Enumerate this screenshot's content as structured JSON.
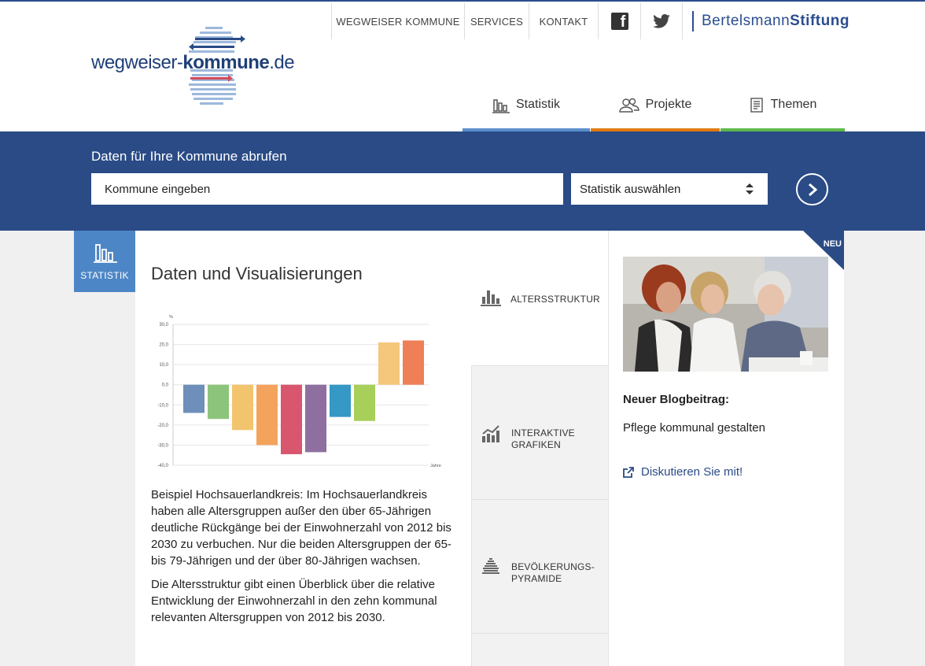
{
  "header": {
    "top_nav": [
      "WEGWEISER KOMMUNE",
      "SERVICES",
      "KONTAKT"
    ],
    "social": [
      "facebook-icon",
      "twitter-icon"
    ],
    "brand_part1": "Bertelsmann",
    "brand_part2": "Stiftung",
    "logo_part1": "wegweiser-",
    "logo_part2": "kommune",
    "logo_part3": ".de",
    "main_nav": [
      {
        "label": "Statistik",
        "color": "#5b8fcb"
      },
      {
        "label": "Projekte",
        "color": "#e07a10"
      },
      {
        "label": "Themen",
        "color": "#5db84a"
      }
    ]
  },
  "search": {
    "title": "Daten für Ihre Kommune abrufen",
    "kommune_placeholder": "Kommune eingeben",
    "statistik_selected": "Statistik auswählen"
  },
  "sidebar_tile": {
    "label": "STATISTIK"
  },
  "main": {
    "title": "Daten und Visualisierungen",
    "paragraphs": [
      "Beispiel Hochsauerlandkreis: Im Hochsauerlandkreis haben alle Altersgruppen außer den über 65-Jährigen deutliche Rückgänge bei der Einwohnerzahl von 2012 bis 2030 zu verbuchen. Nur die beiden Altersgruppen der 65- bis 79-Jährigen und der über 80-Jährigen wachsen.",
      "Die Altersstruktur gibt einen Überblick über die relative Entwicklung der Einwohnerzahl in den zehn kommunal relevanten Altersgruppen von 2012 bis 2030."
    ],
    "side_tabs": [
      {
        "line1": "ALTERSSTRUKTUR",
        "line2": ""
      },
      {
        "line1": "INTERAKTIVE",
        "line2": "GRAFIKEN"
      },
      {
        "line1": "BEVÖLKERUNGS-",
        "line2": "PYRAMIDE"
      }
    ]
  },
  "chart_data": {
    "type": "bar",
    "ylabel": "%",
    "xlabel": "Jahre",
    "ylim": [
      -40,
      30
    ],
    "yticks": [
      "30,0",
      "20,0",
      "10,0",
      "0,0",
      "-10,0",
      "-20,0",
      "-30,0",
      "-40,0"
    ],
    "ytick_values": [
      30,
      20,
      10,
      0,
      -10,
      -20,
      -30,
      -40
    ],
    "values": [
      -14,
      -17,
      -22.5,
      -30,
      -34.5,
      -33.5,
      -16,
      -18,
      21,
      22
    ],
    "colors": [
      "#6d8fba",
      "#8cc47c",
      "#f2c46e",
      "#f4a35d",
      "#d8566e",
      "#8e6fa0",
      "#3698c4",
      "#a8cf5a",
      "#f5c77a",
      "#ee7f57"
    ],
    "grid": true
  },
  "right": {
    "badge": "NEU",
    "blog_label": "Neuer Blogbeitrag:",
    "blog_title": "Pflege kommunal gestalten",
    "discuss": "Diskutieren Sie mit!"
  }
}
